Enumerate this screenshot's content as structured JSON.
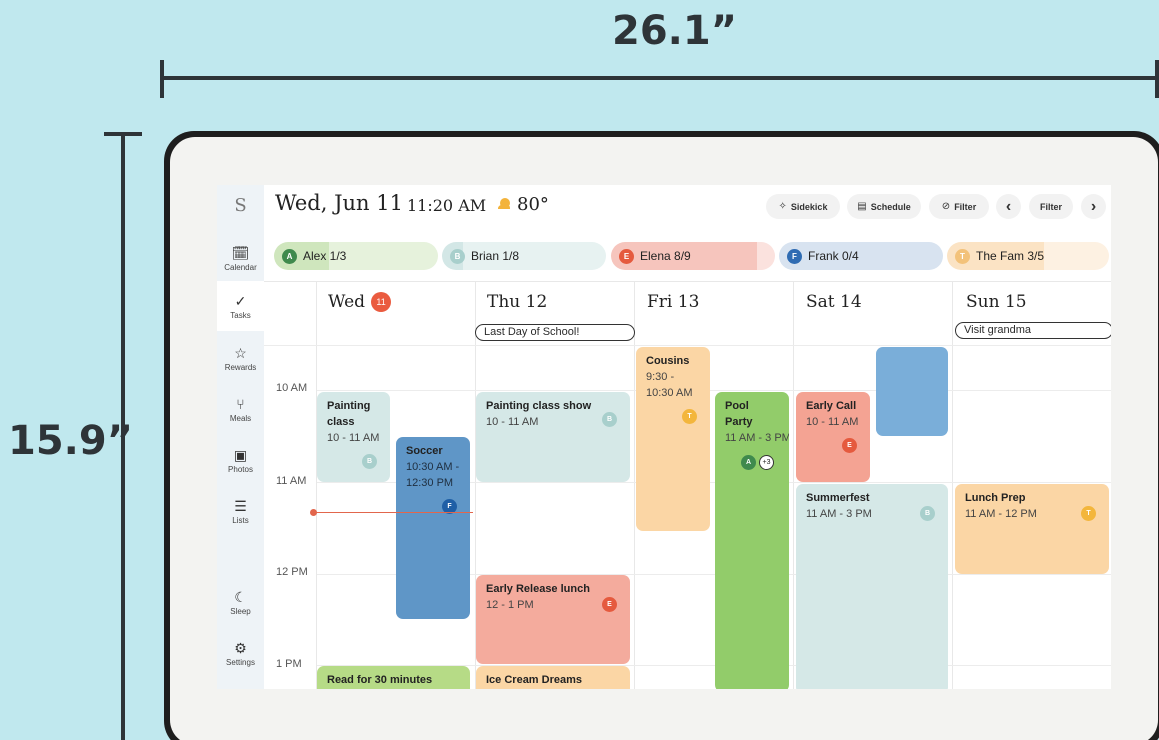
{
  "dimensions": {
    "width_label": "26.1”",
    "height_label": "15.9”"
  },
  "app": {
    "logo": "S"
  },
  "header": {
    "date": "Wed, Jun 11",
    "time": "11:20 AM",
    "temperature": "80°",
    "weather_icon": "partly-sunny-icon"
  },
  "toolbar": {
    "sidekick_label": "Sidekick",
    "schedule_label": "Schedule",
    "filter_label": "Filter",
    "prev_icon": "‹",
    "filter2_label": "Filter",
    "next_icon": "›"
  },
  "sidebar": [
    {
      "label": "Calendar",
      "icon": "🗓"
    },
    {
      "label": "Tasks",
      "icon": "✓"
    },
    {
      "label": "Rewards",
      "icon": "☆"
    },
    {
      "label": "Meals",
      "icon": "⑂"
    },
    {
      "label": "Photos",
      "icon": "▣"
    },
    {
      "label": "Lists",
      "icon": "☰"
    },
    {
      "label": "Sleep",
      "icon": "☾"
    },
    {
      "label": "Settings",
      "icon": "⚙"
    }
  ],
  "people": [
    {
      "initial": "A",
      "label": "Alex 1/3",
      "color": "#3f8a4d",
      "fill_color": "#cfe6bd",
      "bg": "#e6f2dc",
      "progress": 0.333
    },
    {
      "initial": "B",
      "label": "Brian 1/8",
      "color": "#a8cfcc",
      "fill_color": "#d3e7e6",
      "bg": "#e7f2f1",
      "progress": 0.125
    },
    {
      "initial": "E",
      "label": "Elena 8/9",
      "color": "#e55a3e",
      "fill_color": "#f6c5bd",
      "bg": "#fbe2de",
      "progress": 0.889
    },
    {
      "initial": "F",
      "label": "Frank 0/4",
      "color": "#2f6cb3",
      "fill_color": "#d8e3f0",
      "bg": "#d8e3f0",
      "progress": 0.0
    },
    {
      "initial": "T",
      "label": "The Fam 3/5",
      "color": "#f3c27a",
      "fill_color": "#fbe3c4",
      "bg": "#fdf1e2",
      "progress": 0.6
    }
  ],
  "days": [
    {
      "label": "Wed",
      "badge": "11"
    },
    {
      "label": "Thu 12",
      "allday": "Last Day of School!"
    },
    {
      "label": "Fri 13"
    },
    {
      "label": "Sat 14"
    },
    {
      "label": "Sun 15",
      "allday": "Visit grandma"
    }
  ],
  "hours": [
    "10 AM",
    "11 AM",
    "12 PM",
    "1 PM"
  ],
  "events": {
    "painting_class": {
      "title_1": "Painting",
      "title_2": "class",
      "time": "10 - 11 AM",
      "initial": "B"
    },
    "soccer": {
      "title": "Soccer",
      "time_1": "10:30 AM -",
      "time_2": "12:30 PM",
      "initial": "F"
    },
    "read": {
      "title": "Read for 30 minutes"
    },
    "painting_show": {
      "title": "Painting class show",
      "time": "10 - 11 AM",
      "initial": "B"
    },
    "early_release": {
      "title": "Early Release lunch",
      "time": "12 - 1 PM",
      "initial": "E"
    },
    "ice_cream": {
      "title": "Ice Cream Dreams"
    },
    "cousins": {
      "title": "Cousins",
      "time_1": "9:30 -",
      "time_2": "10:30 AM",
      "initial": "T"
    },
    "pool_party": {
      "title_1": "Pool",
      "title_2": "Party",
      "time": "11 AM - 3 PM",
      "initial": "A",
      "more": "+3"
    },
    "early_call": {
      "title": "Early Call",
      "time": "10 - 11 AM",
      "initial": "E"
    },
    "summerfest": {
      "title": "Summerfest",
      "time": "11 AM - 3 PM",
      "initial": "B"
    },
    "lunch_prep": {
      "title": "Lunch Prep",
      "time": "11 AM - 12 PM",
      "initial": "T"
    }
  }
}
